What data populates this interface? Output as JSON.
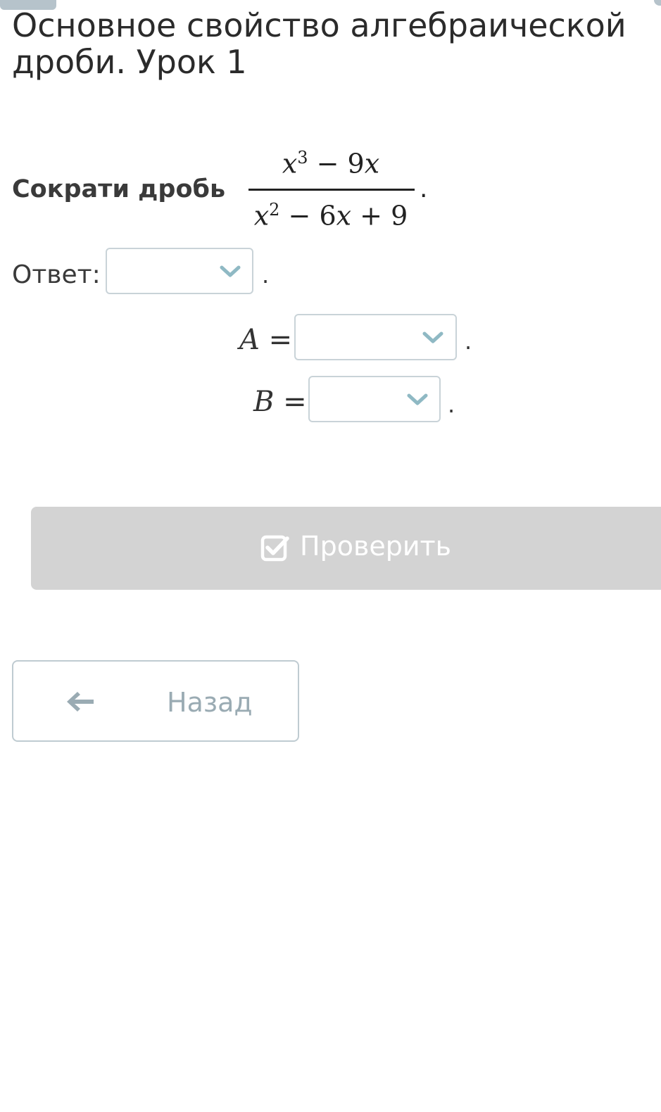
{
  "page": {
    "title": "Основное свойство алгебраической дроби. Урок 1"
  },
  "task": {
    "label": "Сократи дробь",
    "numerator": {
      "base1": "x",
      "exp1": "3",
      "rest": " − 9",
      "var2": "x"
    },
    "denominator": {
      "base1": "x",
      "exp1": "2",
      "rest1": " − 6",
      "var2": "x",
      "rest2": " + 9"
    },
    "trailing_dot": "."
  },
  "answer": {
    "label": "Ответ:",
    "select_value": "",
    "trailing_dot": "."
  },
  "var_a": {
    "name": "A",
    "equals": "=",
    "select_value": "",
    "trailing_dot": "."
  },
  "var_b": {
    "name": "B",
    "equals": "=",
    "select_value": "",
    "trailing_dot": "."
  },
  "buttons": {
    "check_label": "Проверить",
    "back_label": "Назад"
  },
  "icons": {
    "dropdown": "chevron-down-icon",
    "check": "checkbox-check-icon",
    "back": "arrow-left-icon"
  },
  "colors": {
    "chevron": "#8fb9c4",
    "check_button_bg": "#d3d3d3",
    "back_text": "#9aabb3",
    "select_border": "#c9d3d8"
  }
}
